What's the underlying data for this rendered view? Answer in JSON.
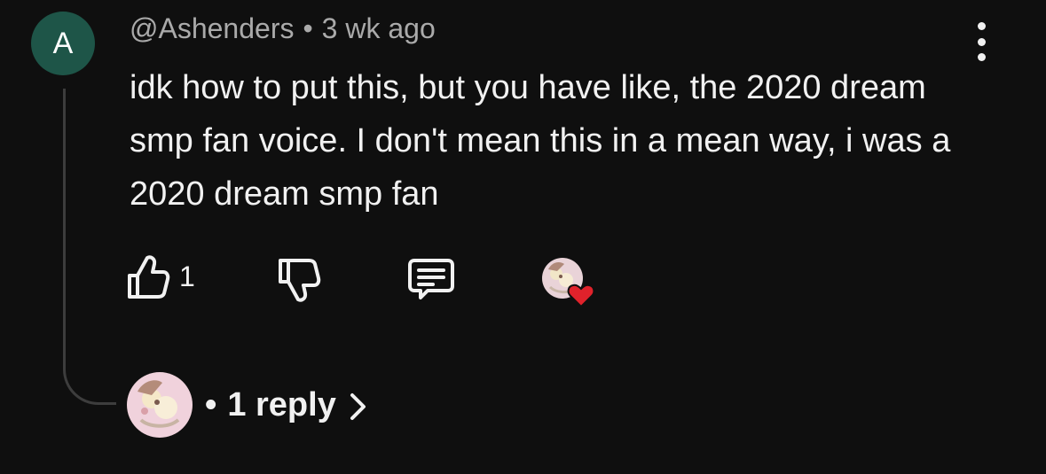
{
  "comment": {
    "avatar_letter": "A",
    "author": "@Ashenders",
    "separator": "•",
    "time_ago": "3 wk ago",
    "text": "idk how to put this, but you have like, the 2020 dream smp fan voice. I don't mean this in a mean way, i was a 2020 dream smp fan",
    "avatar_color": "#1e5548"
  },
  "actions": {
    "like_count": "1",
    "like_icon": "thumbs-up-icon",
    "dislike_icon": "thumbs-down-icon",
    "reply_icon": "comment-icon",
    "creator_heart_icon": "heart-icon",
    "heart_color": "#e0222b"
  },
  "replies": {
    "separator": "•",
    "label": "1 reply",
    "chevron_icon": "chevron-right-icon"
  },
  "menu": {
    "icon": "more-vertical-icon"
  }
}
